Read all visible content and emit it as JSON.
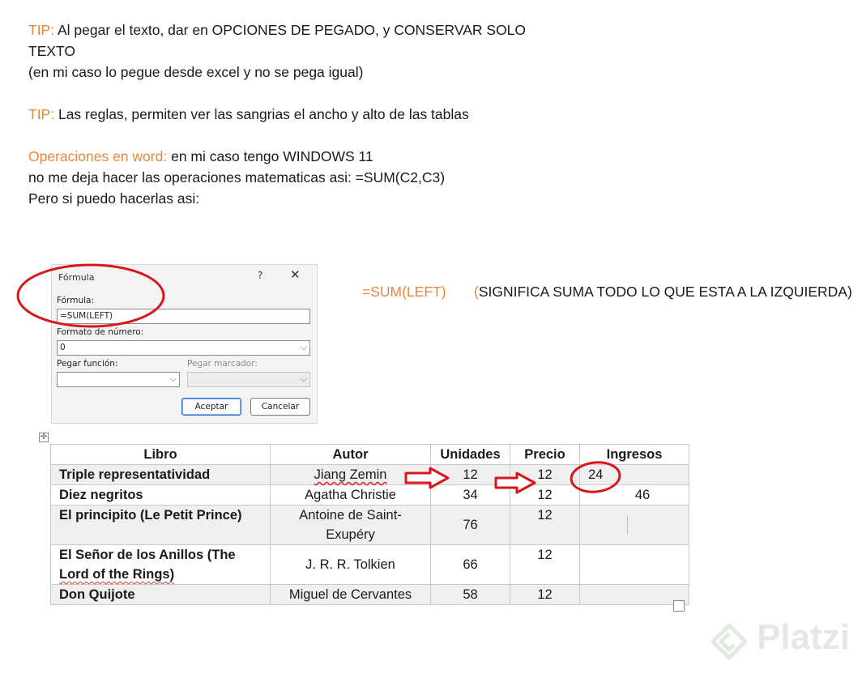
{
  "tips": {
    "tip1_label": "TIP:",
    "tip1_line1": " Al pegar el texto, dar en OPCIONES DE PEGADO, y CONSERVAR SOLO",
    "tip1_line2": "TEXTO",
    "tip1_line3": "(en mi caso lo pegue desde excel y no se pega igual)",
    "tip2_label": "TIP:",
    "tip2_text": " Las reglas, permiten ver las sangrias el ancho y alto de las tablas",
    "ops_label": "Operaciones en word:",
    "ops_text": " en mi caso tengo WINDOWS 11",
    "ops_line2": "no me deja hacer las operaciones matematicas asi: =SUM(C2,C3)",
    "ops_line3": "Pero si puedo hacerlas asi:"
  },
  "dialog": {
    "title": "Fórmula",
    "help": "?",
    "close": "✕",
    "formula_label": "Fórmula:",
    "formula_value": "=SUM(LEFT)",
    "format_label": "Formato de número:",
    "format_value": "0",
    "paste_function_label": "Pegar función:",
    "paste_bookmark_label": "Pegar marcador:",
    "accept": "Aceptar",
    "cancel": "Cancelar"
  },
  "formula_note": {
    "formula": "=SUM(LEFT)",
    "paren_open": "(",
    "meaning": "SIGNIFICA SUMA TODO LO QUE ESTA A LA IZQUIERDA)"
  },
  "table": {
    "headers": [
      "Libro",
      "Autor",
      "Unidades",
      "Precio",
      "Ingresos"
    ],
    "rows": [
      {
        "libro": "Triple representatividad",
        "autor": "Jiang Zemin",
        "unidades": "12",
        "precio": "12",
        "ingresos": "24"
      },
      {
        "libro": "Diez negritos",
        "autor": "Agatha Christie",
        "unidades": "34",
        "precio": "12",
        "ingresos": "46"
      },
      {
        "libro": "El principito (Le Petit Prince)",
        "autor_line1": "Antoine de Saint-",
        "autor_line2": "Exupéry",
        "unidades": "76",
        "precio": "12",
        "ingresos": ""
      },
      {
        "libro_line1": "El Señor de los Anillos (The",
        "libro_line2": "Lord of the Rings)",
        "autor": "J. R. R. Tolkien",
        "unidades": "66",
        "precio": "12",
        "ingresos": ""
      },
      {
        "libro": "Don Quijote",
        "autor": "Miguel de Cervantes",
        "unidades": "58",
        "precio": "12",
        "ingresos": ""
      }
    ]
  },
  "watermark": "Platzi",
  "colors": {
    "accent_orange": "#e8883a",
    "annotation_red": "#d9161c"
  }
}
